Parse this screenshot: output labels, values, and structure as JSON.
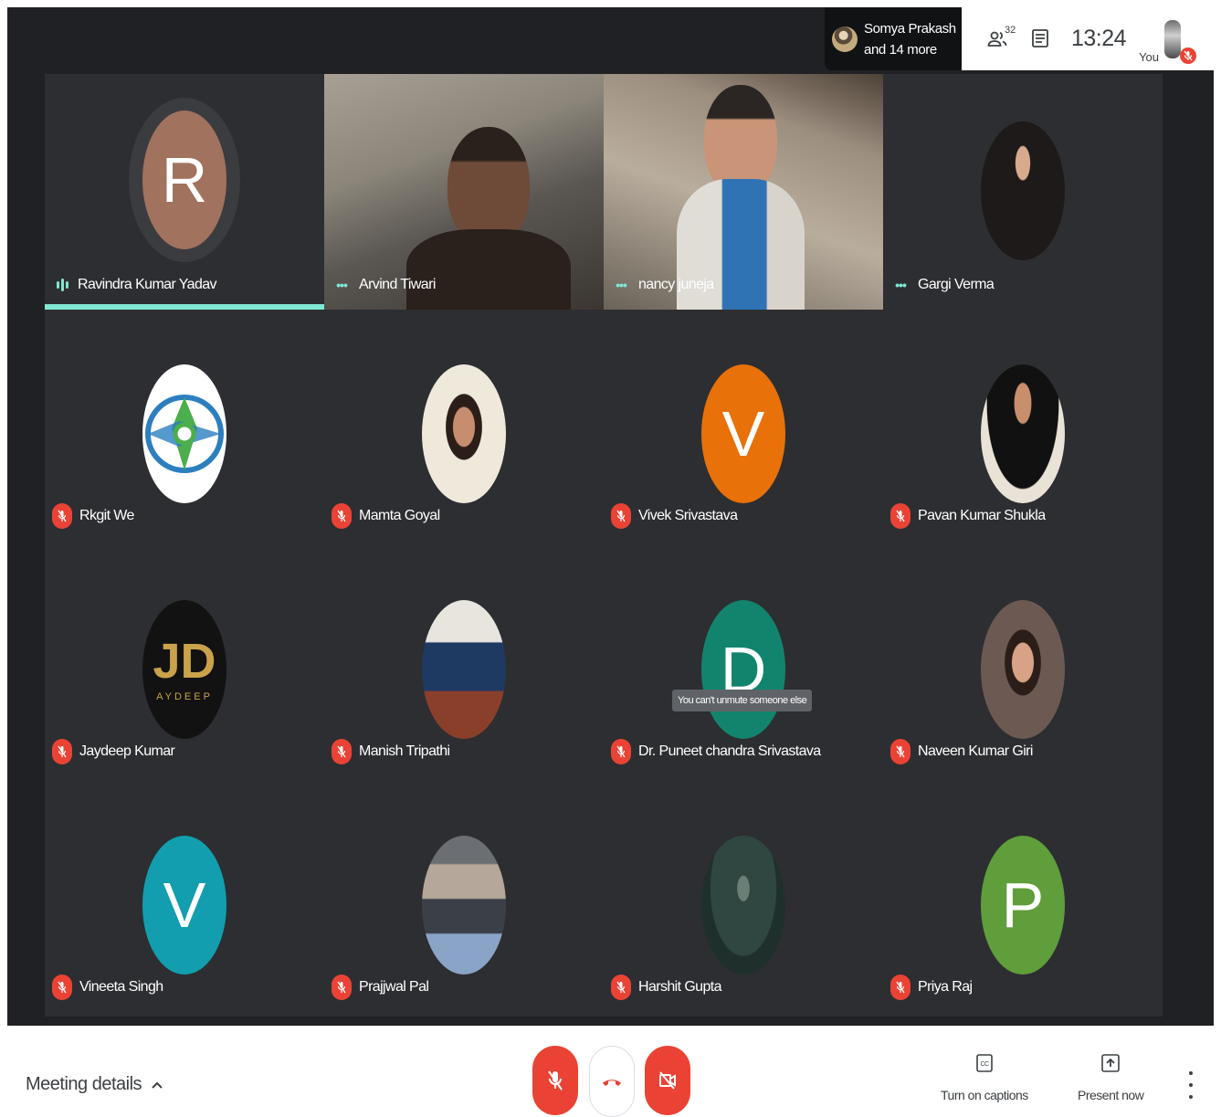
{
  "header": {
    "presenter_name": "Somya Prakash",
    "presenter_more": "and 14 more",
    "people_count": "32",
    "time": "13:24",
    "you_label": "You"
  },
  "colors": {
    "accent": "#7fe7d2",
    "mute_red": "#ea4335",
    "tile_bg": "#2d2e31",
    "stage_bg": "#202124"
  },
  "participants": [
    {
      "name": "Ravindra Kumar Yadav",
      "initial": "R",
      "avatar_color": "#a1725d",
      "state": "speaking"
    },
    {
      "name": "Arvind Tiwari",
      "state": "video"
    },
    {
      "name": "nancy juneja",
      "state": "video"
    },
    {
      "name": "Gargi Verma",
      "state": "photo"
    },
    {
      "name": "Rkgit We",
      "state": "muted"
    },
    {
      "name": "Mamta Goyal",
      "state": "muted"
    },
    {
      "name": "Vivek Srivastava",
      "initial": "V",
      "avatar_color": "#e8710a",
      "state": "muted"
    },
    {
      "name": "Pavan Kumar Shukla",
      "state": "muted"
    },
    {
      "name": "Jaydeep Kumar",
      "avatar_text": "JD",
      "avatar_subtext": "AYDEEP",
      "state": "muted"
    },
    {
      "name": "Manish Tripathi",
      "state": "muted"
    },
    {
      "name": "Dr. Puneet chandra Srivastava",
      "initial": "D",
      "avatar_color": "#12846e",
      "state": "muted"
    },
    {
      "name": "Naveen Kumar Giri",
      "state": "muted"
    },
    {
      "name": "Vineeta Singh",
      "initial": "V",
      "avatar_color": "#129eaf",
      "state": "muted"
    },
    {
      "name": "Prajjwal Pal",
      "state": "muted"
    },
    {
      "name": "Harshit Gupta",
      "state": "muted"
    },
    {
      "name": "Priya Raj",
      "initial": "P",
      "avatar_color": "#5f9e3a",
      "state": "muted"
    }
  ],
  "tooltip": "You can't unmute someone else",
  "footer": {
    "meeting_details": "Meeting details",
    "captions": "Turn on captions",
    "present": "Present now"
  }
}
